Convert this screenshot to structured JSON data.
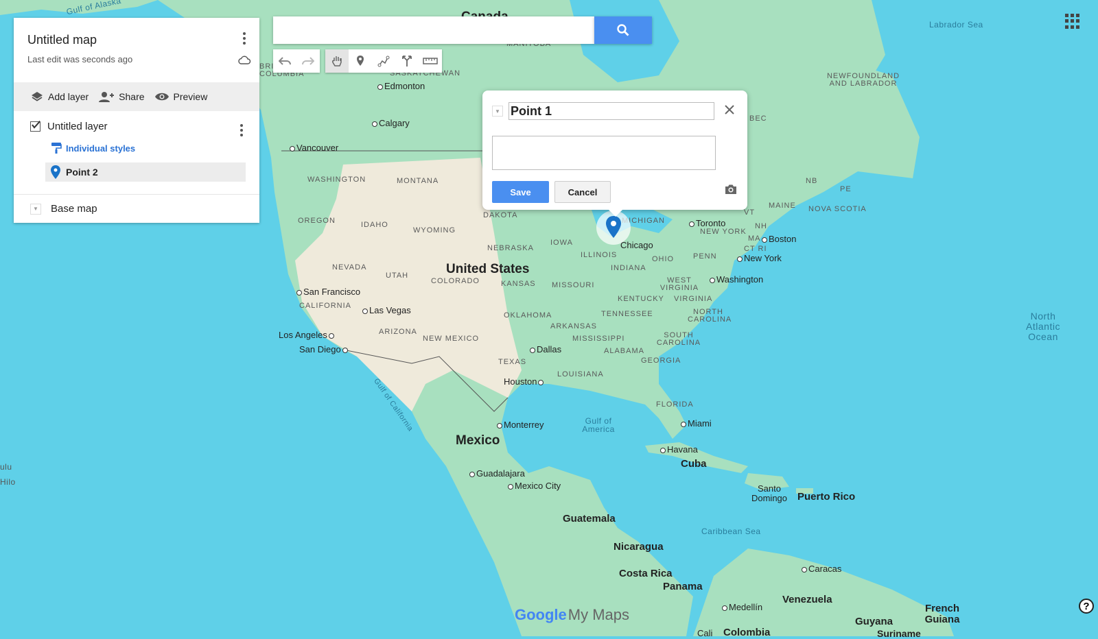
{
  "panel": {
    "title": "Untitled map",
    "subtitle": "Last edit was seconds ago",
    "actions": {
      "add_layer": "Add layer",
      "share": "Share",
      "preview": "Preview"
    },
    "layer": {
      "name": "Untitled layer",
      "styles": "Individual styles",
      "point": "Point 2"
    },
    "basemap": "Base map"
  },
  "search": {
    "value": "",
    "placeholder": ""
  },
  "popup": {
    "name_value": "Point 1",
    "description_value": "",
    "save_label": "Save",
    "cancel_label": "Cancel"
  },
  "brand": {
    "google": "Google",
    "product": "My Maps"
  },
  "map_labels": {
    "gulf_alaska": "Gulf of Alaska",
    "canada": "Canada",
    "labrador_sea": "Labrador Sea",
    "manitoba": "MANITOBA",
    "british_columbia": "BRITISH COLUMBIA",
    "saskatchewan": "SASKATCHEWAN",
    "edmonton": "Edmonton",
    "calgary": "Calgary",
    "vancouver": "Vancouver",
    "quebec": "BEC",
    "newfoundland": "NEWFOUNDLAND AND LABRADOR",
    "washington": "WASHINGTON",
    "montana": "MONTANA",
    "oregon": "OREGON",
    "idaho": "IDAHO",
    "wyoming": "WYOMING",
    "dakota": "DAKOTA",
    "nb": "NB",
    "pe": "PE",
    "maine": "MAINE",
    "nova_scotia": "NOVA SCOTIA",
    "vt": "VT",
    "nh": "NH",
    "ma": "MA",
    "ct": "CT RI",
    "new_york_state": "NEW YORK",
    "michigan": "MICHIGAN",
    "toronto": "Toronto",
    "boston": "Boston",
    "chicago": "Chicago",
    "iowa": "IOWA",
    "nebraska": "NEBRASKA",
    "illinois": "ILLINOIS",
    "ohio": "OHIO",
    "penn": "PENN",
    "new_york": "New York",
    "indiana": "INDIANA",
    "nevada": "NEVADA",
    "utah": "UTAH",
    "colorado": "COLORADO",
    "kansas": "KANSAS",
    "missouri": "MISSOURI",
    "united_states": "United States",
    "washington_dc": "Washington",
    "west_virginia": "WEST VIRGINIA",
    "virginia": "VIRGINIA",
    "kentucky": "KENTUCKY",
    "san_francisco": "San Francisco",
    "california": "CALIFORNIA",
    "las_vegas": "Las Vegas",
    "north_carolina": "NORTH CAROLINA",
    "tennessee": "TENNESSEE",
    "oklahoma": "OKLAHOMA",
    "arizona": "ARIZONA",
    "new_mexico": "NEW MEXICO",
    "arkansas": "ARKANSAS",
    "los_angeles": "Los Angeles",
    "south_carolina": "SOUTH CAROLINA",
    "mississippi": "MISSISSIPPI",
    "alabama": "ALABAMA",
    "san_diego": "San Diego",
    "dallas": "Dallas",
    "georgia": "GEORGIA",
    "texas": "TEXAS",
    "louisiana": "LOUISIANA",
    "houston": "Houston",
    "gulf_california": "Gulf of California",
    "florida": "FLORIDA",
    "miami": "Miami",
    "monterrey": "Monterrey",
    "gulf_america": "Gulf of America",
    "mexico": "Mexico",
    "havana": "Havana",
    "cuba": "Cuba",
    "guadalajara": "Guadalajara",
    "mexico_city": "Mexico City",
    "santo_domingo": "Santo Domingo",
    "puerto_rico": "Puerto Rico",
    "guatemala": "Guatemala",
    "caribbean": "Caribbean Sea",
    "nicaragua": "Nicaragua",
    "costa_rica": "Costa Rica",
    "panama": "Panama",
    "caracas": "Caracas",
    "venezuela": "Venezuela",
    "medellin": "Medellín",
    "french_guiana": "French Guiana",
    "guyana": "Guyana",
    "cali": "Cali",
    "colombia": "Colombia",
    "suriname": "Suriname",
    "north_atlantic": "North Atlantic Ocean",
    "honolulu": "ulu",
    "hilo": "Hilo"
  },
  "colors": {
    "water": "#5fd0e8",
    "land": "#a8e0bf",
    "desert": "#efeadb",
    "accent": "#4a8ff0",
    "marker": "#1a73c8"
  }
}
